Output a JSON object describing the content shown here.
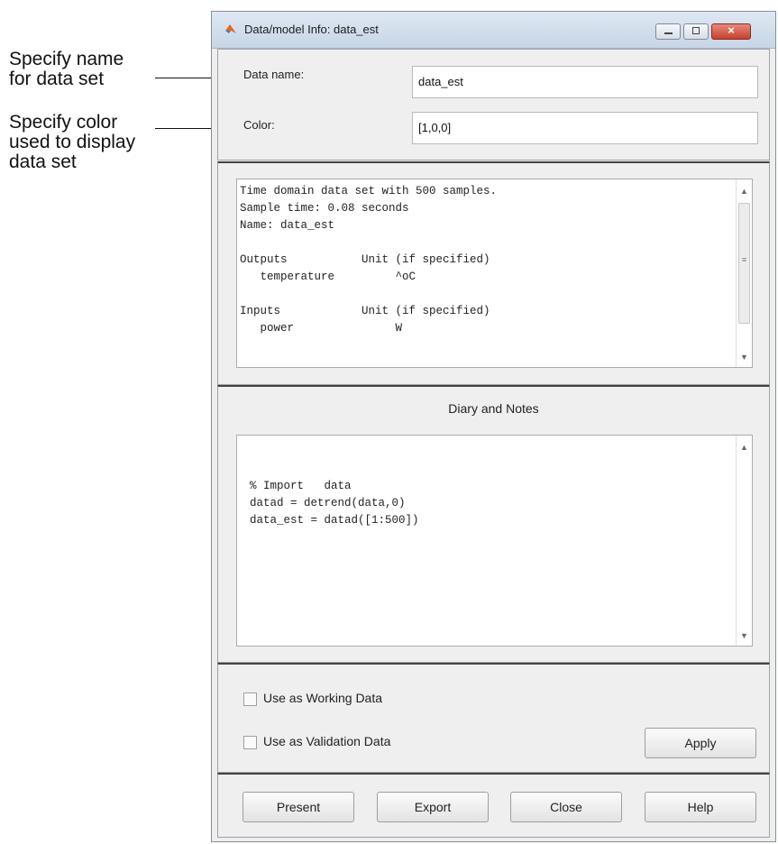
{
  "callouts": {
    "name": "Specify name\nfor data set",
    "color": "Specify color\nused to display\ndata set"
  },
  "window": {
    "title": "Data/model Info: data_est",
    "controls": {
      "minimize": "minimize",
      "maximize": "maximize",
      "close": "×"
    }
  },
  "fields": {
    "data_name_label": "Data name:",
    "data_name_value": "data_est",
    "color_label": "Color:",
    "color_value": "[1,0,0]"
  },
  "info_text": "Time domain data set with 500 samples.\nSample time: 0.08 seconds\nName: data_est\n\nOutputs           Unit (if specified)\n   temperature         ^oC\n\nInputs            Unit (if specified)\n   power               W",
  "notes": {
    "title": "Diary and Notes",
    "text": "% Import   data\ndatad = detrend(data,0)\ndata_est = datad([1:500])"
  },
  "checkboxes": {
    "working": "Use as Working Data",
    "validation": "Use as Validation Data"
  },
  "buttons": {
    "apply": "Apply",
    "present": "Present",
    "export": "Export",
    "close": "Close",
    "help": "Help"
  },
  "icons": {
    "window_icon": "matlab-logo-icon",
    "scroll_up": "scroll-up-arrow-icon",
    "scroll_down": "scroll-down-arrow-icon"
  }
}
